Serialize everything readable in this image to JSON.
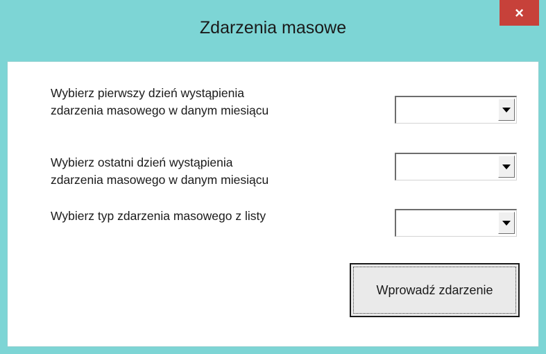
{
  "window": {
    "title": "Zdarzenia masowe",
    "close_glyph": "×",
    "accent_color": "#7dd5d5",
    "close_color": "#c7413a"
  },
  "form": {
    "first_day": {
      "label_line1": "Wybierz pierwszy dzień wystąpienia",
      "label_line2": "zdarzenia masowego w danym miesiącu",
      "value": ""
    },
    "last_day": {
      "label_line1": "Wybierz ostatni dzień wystąpienia",
      "label_line2": "zdarzenia masowego w danym miesiącu",
      "value": ""
    },
    "event_type": {
      "label": "Wybierz typ zdarzenia masowego z listy",
      "value": ""
    },
    "submit_label": "Wprowadź zdarzenie"
  }
}
